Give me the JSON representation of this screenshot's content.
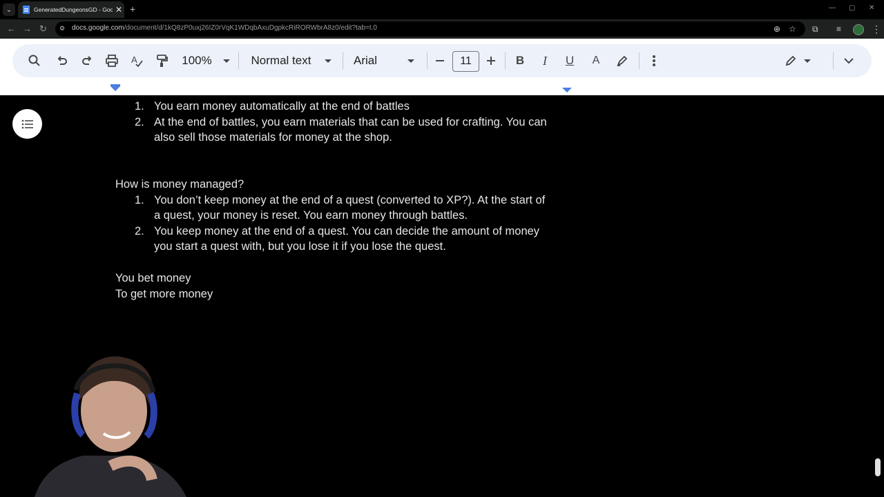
{
  "browser": {
    "tab_title": "GeneratedDungeonsGD - Goog",
    "url_host": "docs.google.com",
    "url_path": "/document/d/1kQ8zP0uxj26IZ0rVqK1WDqbAxuDgpkcRiRORWbrA8z0/edit?tab=t.0"
  },
  "toolbar": {
    "zoom": "100%",
    "style": "Normal text",
    "font": "Arial",
    "font_size": "11",
    "bold": "B",
    "italic": "I",
    "underline": "U",
    "text_color": "A"
  },
  "document": {
    "list1": [
      {
        "num": "1.",
        "lines": [
          "You earn money automatically at the end of battles"
        ]
      },
      {
        "num": "2.",
        "lines": [
          "At the end of battles, you earn materials that can be used for crafting. You can",
          "also sell those materials for money at the shop."
        ]
      }
    ],
    "heading2": "How is money managed?",
    "list2": [
      {
        "num": "1.",
        "lines": [
          "You don’t keep money at the end of a quest (converted to XP?). At the start of",
          "a quest, your money is reset. You earn money through battles."
        ]
      },
      {
        "num": "2.",
        "lines": [
          "You keep money at the end of a quest. You can decide the amount of money",
          "you start a quest with, but you lose it if you lose the quest."
        ]
      }
    ],
    "para1": "You bet money",
    "para2": "To get more money"
  },
  "icons": [
    "search-icon",
    "undo-icon",
    "redo-icon",
    "print-icon",
    "spellcheck-icon",
    "paint-format-icon",
    "minus-icon",
    "plus-icon",
    "highlight-icon",
    "more-icon",
    "edit-mode-icon",
    "collapse-icon",
    "outline-icon"
  ]
}
